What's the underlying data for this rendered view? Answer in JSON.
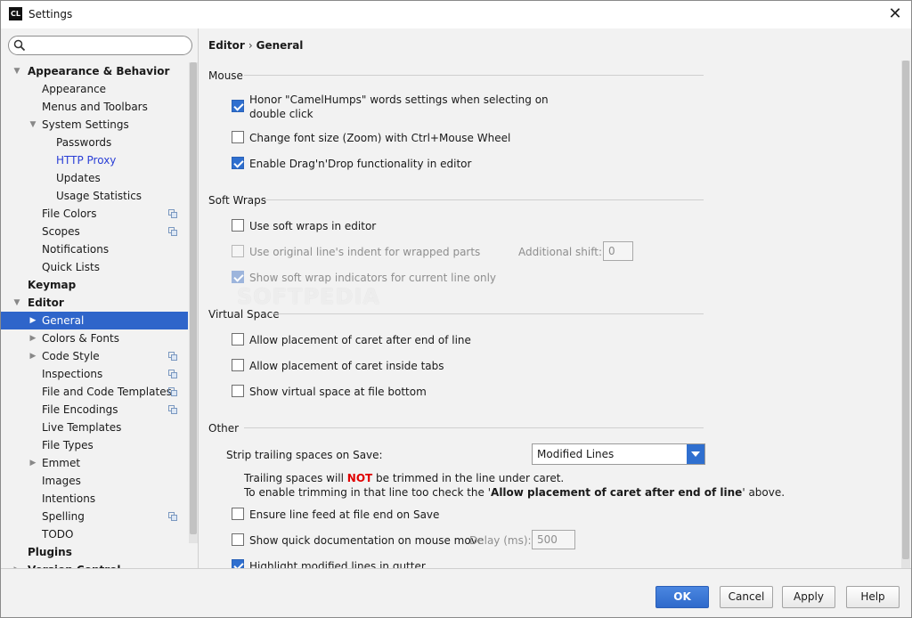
{
  "window": {
    "title": "Settings",
    "app_icon_text": "CL"
  },
  "search": {
    "placeholder": "",
    "value": ""
  },
  "sidebar": {
    "items": [
      {
        "label": "Appearance & Behavior",
        "level": 0,
        "bold": true,
        "arrow": "down"
      },
      {
        "label": "Appearance",
        "level": 1
      },
      {
        "label": "Menus and Toolbars",
        "level": 1
      },
      {
        "label": "System Settings",
        "level": 1,
        "arrow": "down"
      },
      {
        "label": "Passwords",
        "level": 2
      },
      {
        "label": "HTTP Proxy",
        "level": 2,
        "link": true
      },
      {
        "label": "Updates",
        "level": 2
      },
      {
        "label": "Usage Statistics",
        "level": 2
      },
      {
        "label": "File Colors",
        "level": 1,
        "copy": true
      },
      {
        "label": "Scopes",
        "level": 1,
        "copy": true
      },
      {
        "label": "Notifications",
        "level": 1
      },
      {
        "label": "Quick Lists",
        "level": 1
      },
      {
        "label": "Keymap",
        "level": 0,
        "bold": true
      },
      {
        "label": "Editor",
        "level": 0,
        "bold": true,
        "arrow": "down"
      },
      {
        "label": "General",
        "level": 1,
        "arrow": "right",
        "selected": true
      },
      {
        "label": "Colors & Fonts",
        "level": 1,
        "arrow": "right"
      },
      {
        "label": "Code Style",
        "level": 1,
        "arrow": "right",
        "copy": true
      },
      {
        "label": "Inspections",
        "level": 1,
        "copy": true
      },
      {
        "label": "File and Code Templates",
        "level": 1,
        "copy": true
      },
      {
        "label": "File Encodings",
        "level": 1,
        "copy": true
      },
      {
        "label": "Live Templates",
        "level": 1
      },
      {
        "label": "File Types",
        "level": 1
      },
      {
        "label": "Emmet",
        "level": 1,
        "arrow": "right"
      },
      {
        "label": "Images",
        "level": 1
      },
      {
        "label": "Intentions",
        "level": 1
      },
      {
        "label": "Spelling",
        "level": 1,
        "copy": true
      },
      {
        "label": "TODO",
        "level": 1
      },
      {
        "label": "Plugins",
        "level": 0,
        "bold": true
      },
      {
        "label": "Version Control",
        "level": 0,
        "bold": true,
        "arrow": "right"
      }
    ]
  },
  "breadcrumb": {
    "parent": "Editor",
    "separator": "›",
    "current": "General"
  },
  "sections": {
    "mouse": "Mouse",
    "soft_wraps": "Soft Wraps",
    "virtual_space": "Virtual Space",
    "other": "Other"
  },
  "options": {
    "camelhumps_line1": "Honor \"CamelHumps\" words settings when selecting on",
    "camelhumps_line2": "double click",
    "zoom": "Change font size (Zoom) with Ctrl+Mouse Wheel",
    "dragdrop": "Enable Drag'n'Drop functionality in editor",
    "soft_wraps": "Use soft wraps in editor",
    "orig_indent": "Use original line's indent for wrapped parts",
    "additional_shift_label": "Additional shift:",
    "additional_shift_value": "0",
    "wrap_indicators": "Show soft wrap indicators for current line only",
    "caret_after_end": "Allow placement of caret after end of line",
    "caret_inside_tabs": "Allow placement of caret inside tabs",
    "virtual_space_bottom": "Show virtual space at file bottom",
    "strip_trailing_label": "Strip trailing spaces on Save:",
    "strip_trailing_value": "Modified Lines",
    "info_line1_pre": "Trailing spaces will ",
    "info_line1_not": "NOT",
    "info_line1_post": " be trimmed in the line under caret.",
    "info_line2_pre": "To enable trimming in that line too check the '",
    "info_line2_bold": "Allow placement of caret after end of line",
    "info_line2_post": "' above.",
    "line_feed": "Ensure line feed at file end on Save",
    "quick_doc": "Show quick documentation on mouse move",
    "delay_label": "Delay (ms):",
    "delay_value": "500",
    "highlight_modified": "Highlight modified lines in gutter"
  },
  "watermark": "SOFTPEDIA",
  "buttons": {
    "ok": "OK",
    "cancel": "Cancel",
    "apply": "Apply",
    "help": "Help"
  },
  "colors": {
    "accent": "#2f6fcf",
    "selection": "#2f65ca",
    "link": "#2a3fd6",
    "warning": "#e00000"
  }
}
